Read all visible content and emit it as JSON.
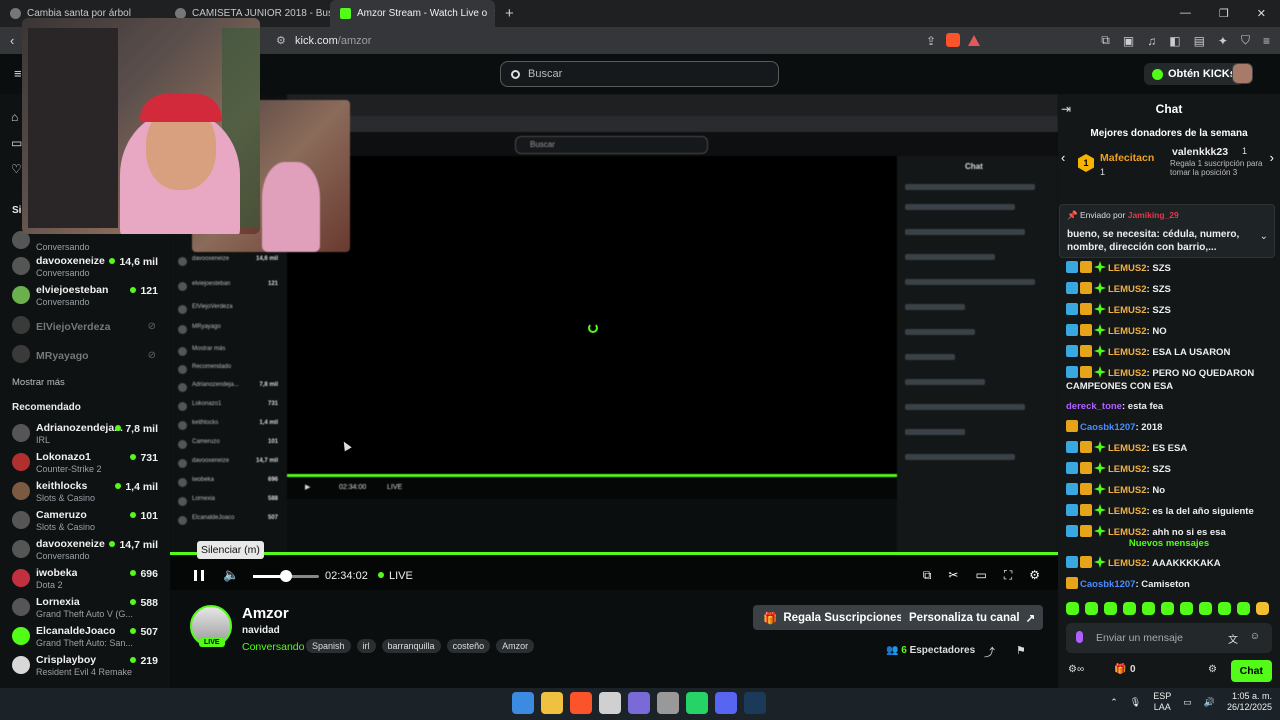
{
  "browser": {
    "tabs": [
      {
        "title": "Cambia santa por árbol",
        "active": false
      },
      {
        "title": "CAMISETA JUNIOR 2018 - Buscar con",
        "active": false
      },
      {
        "title": "Amzor Stream - Watch Live o",
        "active": true
      }
    ],
    "url_host": "kick.com",
    "url_path": "/amzor"
  },
  "header": {
    "search_placeholder": "Buscar",
    "obten_label": "Obtén KICKs"
  },
  "sidebar": {
    "following_label": "Sig",
    "following": [
      {
        "name": "",
        "sub": "Conversando",
        "viewers": ""
      },
      {
        "name": "davooxeneize",
        "sub": "Conversando",
        "viewers": "14,6 mil"
      },
      {
        "name": "elviejoesteban",
        "sub": "Conversando",
        "viewers": "121"
      },
      {
        "name": "ElViejoVerdeza",
        "offline": true
      },
      {
        "name": "MRyayago",
        "offline": true
      }
    ],
    "show_more": "Mostrar más",
    "recommended_label": "Recomendado",
    "recommended": [
      {
        "name": "Adrianozendeja...",
        "sub": "IRL",
        "viewers": "7,8 mil"
      },
      {
        "name": "Lokonazo1",
        "sub": "Counter-Strike 2",
        "viewers": "731"
      },
      {
        "name": "keithlocks",
        "sub": "Slots & Casino",
        "viewers": "1,4 mil"
      },
      {
        "name": "Cameruzo",
        "sub": "Slots & Casino",
        "viewers": "101"
      },
      {
        "name": "davooxeneize",
        "sub": "Conversando",
        "viewers": "14,7 mil"
      },
      {
        "name": "iwobeka",
        "sub": "Dota 2",
        "viewers": "696"
      },
      {
        "name": "Lornexia",
        "sub": "Grand Theft Auto V (G...",
        "viewers": "588"
      },
      {
        "name": "ElcanaldeJoaco",
        "sub": "Grand Theft Auto: San...",
        "viewers": "507"
      },
      {
        "name": "Crisplayboy",
        "sub": "Resident Evil 4 Remake",
        "viewers": "219"
      }
    ]
  },
  "player": {
    "tooltip": "Silenciar (m)",
    "time": "02:34:02",
    "live": "LIVE",
    "volume_fraction": 0.5,
    "nested": {
      "search": "Buscar",
      "chat": "Chat",
      "time": "02:34:00",
      "live": "LIVE",
      "rows": [
        {
          "name": "davooxeneize",
          "viewers": "14,6 mil"
        },
        {
          "name": "elviejoesteban",
          "viewers": "121"
        },
        {
          "name": "ElViejoVerdeza",
          "viewers": ""
        },
        {
          "name": "MRyayago",
          "viewers": ""
        },
        {
          "name": "Mostrar más",
          "viewers": ""
        },
        {
          "name": "Recomendado",
          "viewers": ""
        },
        {
          "name": "Adrianozendeja...",
          "viewers": "7,8 mil"
        },
        {
          "name": "Lokonazo1",
          "viewers": "731"
        },
        {
          "name": "keithlocks",
          "viewers": "1,4 mil"
        },
        {
          "name": "Cameruzo",
          "viewers": "101"
        },
        {
          "name": "davooxeneize",
          "viewers": "14,7 mil"
        },
        {
          "name": "iwobeka",
          "viewers": "696"
        },
        {
          "name": "Lornexia",
          "viewers": "588"
        },
        {
          "name": "ElcanaldeJoaco",
          "viewers": "507"
        }
      ]
    }
  },
  "stream": {
    "name": "Amzor",
    "title": "navidad",
    "category": "Conversando",
    "live_badge": "LIVE",
    "tags": [
      "Spanish",
      "irl",
      "barranquilla",
      "costeño",
      "Amzor"
    ],
    "btn_subs": "Regala Suscripciones",
    "btn_customize": "Personaliza tu canal",
    "viewers_count": "6",
    "viewers_label": "Espectadores"
  },
  "chat": {
    "title": "Chat",
    "donors_title": "Mejores donadores de la semana",
    "donor1": {
      "rank": "1",
      "name": "Mafecitacn",
      "count": "1"
    },
    "donor2": {
      "name": "valenkkk23",
      "count": "1",
      "sub": "Regala 1 suscripción para tomar la posición 3"
    },
    "pinned_by_label": "Enviado por",
    "pinned_by_user": "Jamiking_29",
    "pinned_msg": "bueno, se necesita: cédula, numero, nombre, dirección con barrio,...",
    "messages": [
      {
        "user": "LEMUS2",
        "text": "SZS",
        "color": "orange",
        "badges": [
          "blue",
          "gold",
          "green"
        ]
      },
      {
        "user": "LEMUS2",
        "text": "SZS",
        "color": "orange",
        "badges": [
          "blue",
          "gold",
          "green"
        ]
      },
      {
        "user": "LEMUS2",
        "text": "SZS",
        "color": "orange",
        "badges": [
          "blue",
          "gold",
          "green"
        ]
      },
      {
        "user": "LEMUS2",
        "text": "NO",
        "color": "orange",
        "badges": [
          "blue",
          "gold",
          "green"
        ]
      },
      {
        "user": "LEMUS2",
        "text": "ESA LA USARON",
        "color": "orange",
        "badges": [
          "blue",
          "gold",
          "green"
        ]
      },
      {
        "user": "LEMUS2",
        "text": "PERO NO QUEDARON CAMPEONES CON ESA",
        "color": "orange",
        "badges": [
          "blue",
          "gold",
          "green"
        ]
      },
      {
        "user": "dereck_tone",
        "text": "esta fea",
        "color": "purple",
        "badges": []
      },
      {
        "user": "Caosbk1207",
        "text": "2018",
        "color": "blue",
        "badges": [
          "gold"
        ]
      },
      {
        "user": "LEMUS2",
        "text": "ES ESA",
        "color": "orange",
        "badges": [
          "blue",
          "gold",
          "green"
        ]
      },
      {
        "user": "LEMUS2",
        "text": "SZS",
        "color": "orange",
        "badges": [
          "blue",
          "gold",
          "green"
        ]
      },
      {
        "user": "LEMUS2",
        "text": "No",
        "color": "orange",
        "badges": [
          "blue",
          "gold",
          "green"
        ]
      },
      {
        "user": "LEMUS2",
        "text": "es la del año siguiente",
        "color": "orange",
        "badges": [
          "blue",
          "gold",
          "green"
        ]
      },
      {
        "user": "LEMUS2",
        "text": "ahh no si es esa",
        "color": "orange",
        "badges": [
          "blue",
          "gold",
          "green"
        ]
      }
    ],
    "new_messages_label": "Nuevos mensajes",
    "new_messages": [
      {
        "user": "LEMUS2",
        "text": "AAAKKKKAKA",
        "color": "orange",
        "badges": [
          "blue",
          "gold",
          "green"
        ]
      },
      {
        "user": "Caosbk1207",
        "text": "Camiseton",
        "color": "blue",
        "badges": [
          "gold"
        ]
      }
    ],
    "input_placeholder": "Enviar un mensaje",
    "kicks_count": "0",
    "send_label": "Chat"
  },
  "taskbar": {
    "lang_top": "ESP",
    "lang_bottom": "LAA",
    "time": "1:05 a. m.",
    "date": "26/12/2025"
  },
  "colors": {
    "kick_green": "#53fc18",
    "bg": "#0b0e0f",
    "username_orange": "#f0b040",
    "username_purple": "#b060ff",
    "username_blue": "#4a8cff"
  }
}
